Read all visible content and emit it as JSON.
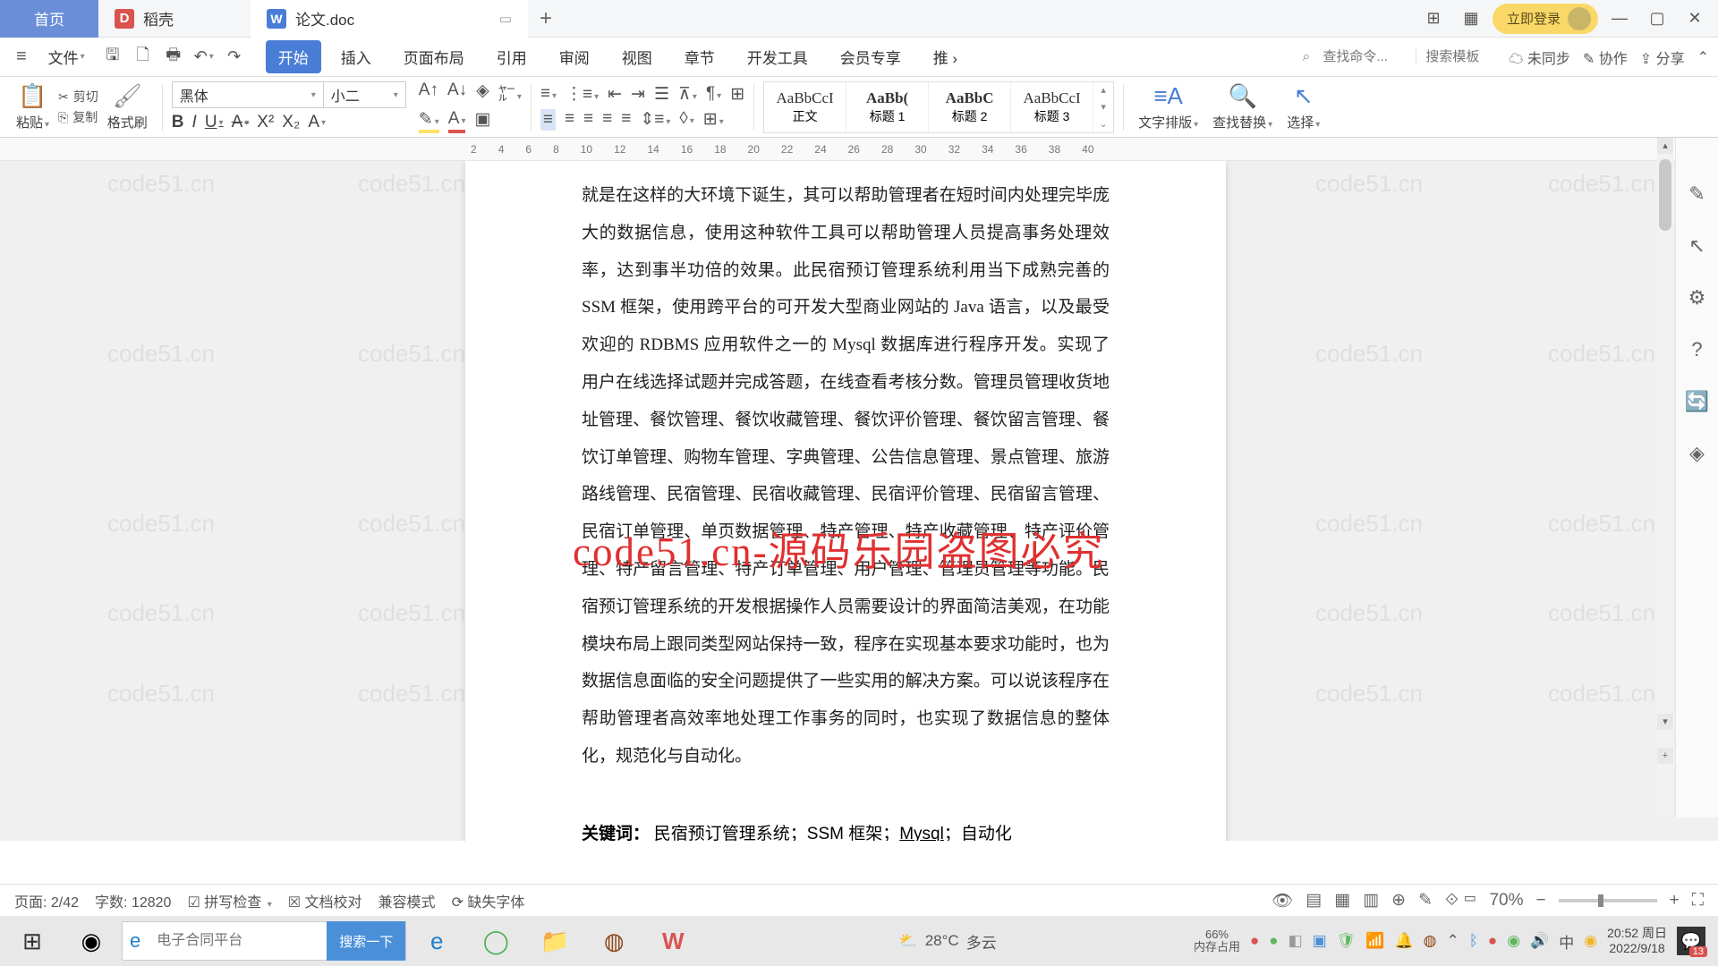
{
  "titlebar": {
    "home": "首页",
    "dk": "稻壳",
    "doc": "论文.doc",
    "login": "立即登录"
  },
  "file_menu": "文件",
  "quick": {
    "cut": "剪切",
    "copy": "复制",
    "format": "格式刷",
    "paste": "粘贴"
  },
  "ribbon_tabs": [
    "开始",
    "插入",
    "页面布局",
    "引用",
    "审阅",
    "视图",
    "章节",
    "开发工具",
    "会员专享",
    "推"
  ],
  "menubar_right": {
    "unsync": "未同步",
    "coop": "协作",
    "share": "分享",
    "search_cmd": "查找命令...",
    "search_tpl": "搜索模板"
  },
  "font": {
    "name": "黑体",
    "size": "小二"
  },
  "styles": [
    {
      "preview": "AaBbCcI",
      "name": "正文"
    },
    {
      "preview": "AaBb(",
      "name": "标题 1"
    },
    {
      "preview": "AaBbC",
      "name": "标题 2"
    },
    {
      "preview": "AaBbCcI",
      "name": "标题 3"
    }
  ],
  "big_buttons": {
    "layout": "文字排版",
    "find": "查找替换",
    "select": "选择"
  },
  "ruler": [
    "2",
    "4",
    "6",
    "8",
    "10",
    "12",
    "14",
    "16",
    "18",
    "20",
    "22",
    "24",
    "26",
    "28",
    "30",
    "32",
    "34",
    "36",
    "38",
    "40"
  ],
  "document": {
    "body": "就是在这样的大环境下诞生，其可以帮助管理者在短时间内处理完毕庞大的数据信息，使用这种软件工具可以帮助管理人员提高事务处理效率，达到事半功倍的效果。此民宿预订管理系统利用当下成熟完善的 SSM 框架，使用跨平台的可开发大型商业网站的 Java 语言，以及最受欢迎的 RDBMS 应用软件之一的 Mysql 数据库进行程序开发。实现了用户在线选择试题并完成答题，在线查看考核分数。管理员管理收货地址管理、餐饮管理、餐饮收藏管理、餐饮评价管理、餐饮留言管理、餐饮订单管理、购物车管理、字典管理、公告信息管理、景点管理、旅游路线管理、民宿管理、民宿收藏管理、民宿评价管理、民宿留言管理、民宿订单管理、单页数据管理、特产管理、特产收藏管理、特产评价管理、特产留言管理、特产订单管理、用户管理、管理员管理等功能。民宿预订管理系统的开发根据操作人员需要设计的界面简洁美观，在功能模块布局上跟同类型网站保持一致，程序在实现基本要求功能时，也为数据信息面临的安全问题提供了一些实用的解决方案。可以说该程序在帮助管理者高效率地处理工作事务的同时，也实现了数据信息的整体化，规范化与自动化。",
    "kw_label": "关键词：",
    "kw_text": "民宿预订管理系统；SSM 框架；Mysql；自动化"
  },
  "overlay": "code51.cn-源码乐园盗图必究",
  "watermark_text": "code51.cn",
  "statusbar": {
    "page": "页面: 2/42",
    "words": "字数: 12820",
    "spell": "拼写检查",
    "proof": "文档校对",
    "compat": "兼容模式",
    "missing": "缺失字体",
    "zoom": "70%"
  },
  "taskbar": {
    "search_ph": "电子合同平台",
    "search_btn": "搜索一下",
    "weather_temp": "28°C",
    "weather_desc": "多云",
    "mem": "66%",
    "mem_label": "内存占用",
    "ime": "中",
    "time": "20:52 周日",
    "date": "2022/9/18",
    "notif": "13"
  }
}
